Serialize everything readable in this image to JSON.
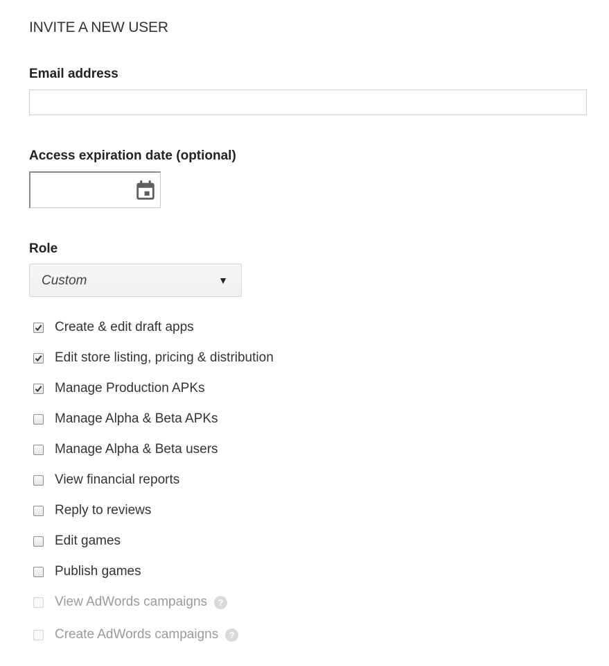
{
  "header": {
    "title": "INVITE A NEW USER"
  },
  "email": {
    "label": "Email address",
    "value": "",
    "placeholder": ""
  },
  "expiration": {
    "label": "Access expiration date (optional)",
    "value": ""
  },
  "role": {
    "label": "Role",
    "selected": "Custom",
    "arrow": "▼"
  },
  "permissions": [
    {
      "label": "Create & edit draft apps",
      "checked": true,
      "disabled": false
    },
    {
      "label": "Edit store listing, pricing & distribution",
      "checked": true,
      "disabled": false
    },
    {
      "label": "Manage Production APKs",
      "checked": true,
      "disabled": false
    },
    {
      "label": "Manage Alpha & Beta APKs",
      "checked": false,
      "disabled": false
    },
    {
      "label": "Manage Alpha & Beta users",
      "checked": false,
      "disabled": false
    },
    {
      "label": "View financial reports",
      "checked": false,
      "disabled": false
    },
    {
      "label": "Reply to reviews",
      "checked": false,
      "disabled": false
    },
    {
      "label": "Edit games",
      "checked": false,
      "disabled": false
    },
    {
      "label": "Publish games",
      "checked": false,
      "disabled": false
    },
    {
      "label": "View AdWords campaigns",
      "checked": false,
      "disabled": true,
      "help": "?"
    },
    {
      "label": "Create AdWords campaigns",
      "checked": false,
      "disabled": true,
      "help": "?"
    }
  ],
  "icons": {
    "calendar": "calendar-icon",
    "help": "help-icon",
    "check": "checkmark-icon"
  },
  "colors": {
    "text": "#333333",
    "disabled_text": "#9a9a9a",
    "border": "#cfcfcf",
    "help_bg": "#d9d9d9"
  }
}
